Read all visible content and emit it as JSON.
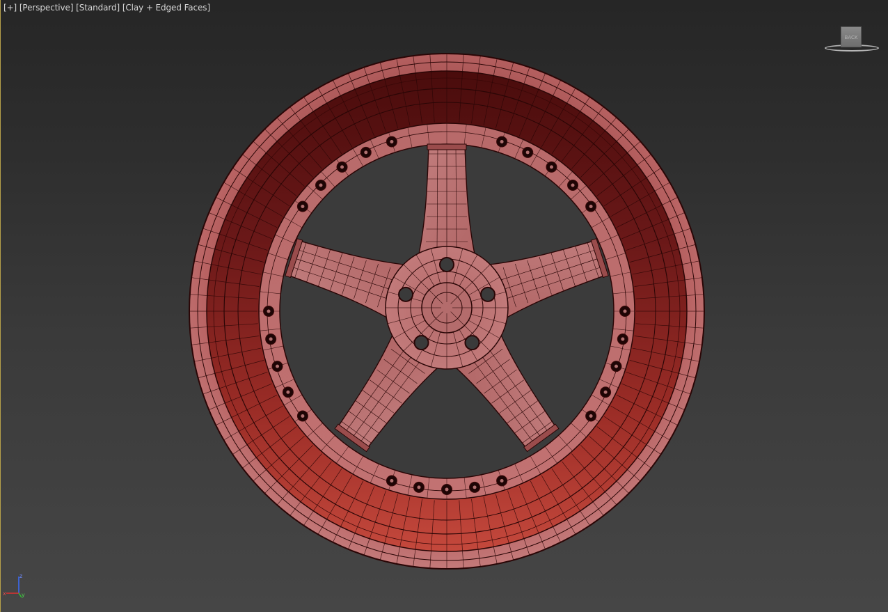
{
  "viewport": {
    "labels": [
      "[+]",
      "[Perspective]",
      "[Standard]",
      "[Clay + Edged Faces]"
    ],
    "object": "wheel-rim-mesh",
    "colors": {
      "mesh_light": "#c87a7a",
      "mesh_dark": "#5e1616",
      "mesh_accent": "#c2433a",
      "edge": "#2a0606",
      "background_top": "#262626",
      "background_bottom": "#464646"
    }
  },
  "viewcube": {
    "face_label": "BACK"
  },
  "axis_tripod": {
    "x": "x",
    "y": "y",
    "z": "z"
  }
}
